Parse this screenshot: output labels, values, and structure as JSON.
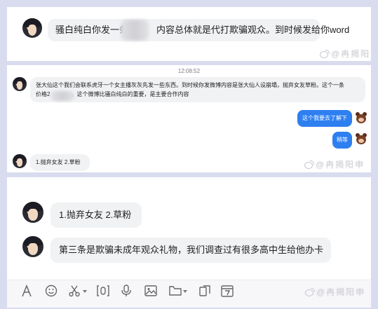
{
  "panel1": {
    "message": {
      "before": "骚白纯白你发一条",
      "after": "内容总体就是代打欺骗观众。到时候发给你word"
    },
    "watermark": "@冉揭阳申"
  },
  "panel2": {
    "timestamp": "12:08:52",
    "message_in": {
      "line1": "张大仙这个我们会联系虎牙一个女主播灰灰先发一些东西。到时候你发微博内容是张大仙人设崩塌，抛弃女友草粉。这个一条",
      "line2_before": "价格2",
      "line2_after": "。这个微博比骚白纯白的重要，是主要合作内容"
    },
    "reply1": "这个我要去了解下",
    "reply2": "稍等",
    "message_in2": "1.抛弃女友 2.草粉",
    "watermark": "@冉揭阳申"
  },
  "panel3": {
    "message1": "1.抛弃女友 2.草粉",
    "message2": "第三条是欺骗未成年观众礼物，我们调查过有很多高中生给他办卡",
    "watermark": "@冉揭阳申",
    "toolbar": [
      "font-icon",
      "emoji-icon",
      "scissors-icon",
      "screenshot-icon",
      "microphone-icon",
      "image-icon",
      "folder-icon",
      "clipboard-icon",
      "calendar-icon"
    ]
  },
  "colors": {
    "background": "#d9dcee",
    "bubble_in": "#f1f2f4",
    "bubble_out": "#2e7ff0"
  }
}
